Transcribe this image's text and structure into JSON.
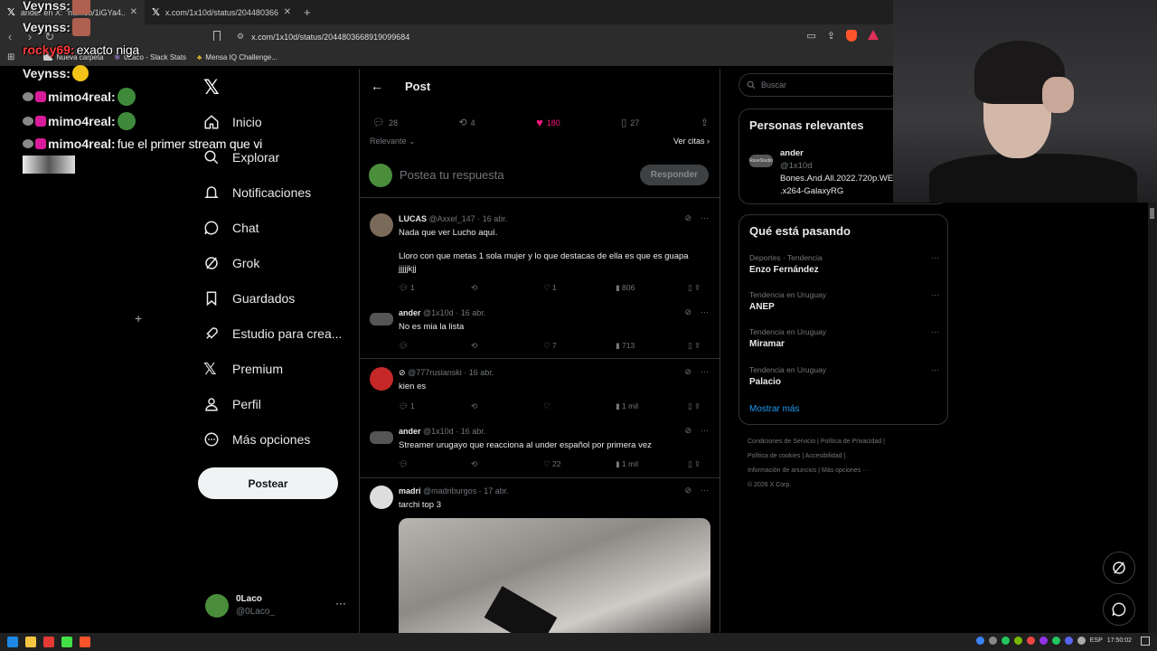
{
  "browser": {
    "tabs": [
      {
        "title": "ander en X: \"htt...co/1iGYa4...",
        "active": true
      },
      {
        "title": "x.com/1x10d/status/20448036689190",
        "active": false
      }
    ],
    "url": "x.com/1x10d/status/2044803668919099684",
    "bookmarks": [
      "Nueva carpeta",
      "0Laco - Slack Stats",
      "Mensa IQ Challenge..."
    ]
  },
  "chat": [
    {
      "name": "Veynss:",
      "msg": "",
      "emote": "face"
    },
    {
      "name": "Veynss:",
      "msg": "",
      "emote": "face"
    },
    {
      "name": "rocky69:",
      "msg": "exacto niga",
      "red": true
    },
    {
      "name": "Veynss:",
      "msg": "",
      "emote": "yellow"
    },
    {
      "name": "mimo4real:",
      "msg": "",
      "emote": "frog"
    },
    {
      "name": "mimo4real:",
      "msg": "",
      "emote": "frog"
    },
    {
      "name": "mimo4real:",
      "msg": "fue el primer stream que vi"
    }
  ],
  "nav": {
    "items": [
      "Inicio",
      "Explorar",
      "Notificaciones",
      "Chat",
      "Grok",
      "Guardados",
      "Estudio para crea...",
      "Premium",
      "Perfil",
      "Más opciones"
    ],
    "post_button": "Postear",
    "account": {
      "name": "0Laco",
      "handle": "@0Laco_"
    }
  },
  "main": {
    "title": "Post",
    "stats": {
      "replies": "28",
      "reposts": "4",
      "likes": "180",
      "bookmarks": "27"
    },
    "sort_label": "Relevante",
    "quotes_label": "Ver citas",
    "reply_placeholder": "Postea tu respuesta",
    "reply_button": "Responder",
    "tweets": [
      {
        "name": "LUCAS",
        "handle": "@Axxel_147",
        "date": "· 16 abr.",
        "text1": "Nada que ver Lucho aquí.",
        "text2": "Lloro con que metas 1 sola mujer y lo que destacas de ella es que es guapa jjjjjkjj",
        "replies": "1",
        "reposts": "",
        "likes": "1",
        "views": "806"
      },
      {
        "name": "ander",
        "handle": "@1x10d",
        "date": "· 16 abr.",
        "text1": "No es mia la lista",
        "replies": "",
        "reposts": "",
        "likes": "7",
        "views": "713"
      },
      {
        "name": "",
        "handle": "@777ruslanski",
        "date": "· 16 abr.",
        "text1": "kien es",
        "replies": "1",
        "reposts": "",
        "likes": "",
        "views": "1 mil"
      },
      {
        "name": "ander",
        "handle": "@1x10d",
        "date": "· 16 abr.",
        "text1": "Streamer urugayo que reacciona al under español por primera vez",
        "replies": "",
        "reposts": "",
        "likes": "22",
        "views": "1 mil"
      },
      {
        "name": "madri",
        "handle": "@madriburgos",
        "date": "· 17 abr.",
        "text1": "tarchi top 3"
      }
    ]
  },
  "right": {
    "search_placeholder": "Buscar",
    "relevant_title": "Personas relevantes",
    "person": {
      "name": "ander",
      "handle": "@1x10d",
      "bio1": "Bones.And.All.2022.720p.WEB",
      "bio2": ".x264-GalaxyRG",
      "avatar_label": "RaveStudio"
    },
    "trending_title": "Qué está pasando",
    "trends": [
      {
        "context": "Deportes · Tendencia",
        "name": "Enzo Fernández"
      },
      {
        "context": "Tendencia en Uruguay",
        "name": "ANEP"
      },
      {
        "context": "Tendencia en Uruguay",
        "name": "Miramar"
      },
      {
        "context": "Tendencia en Uruguay",
        "name": "Palacio"
      }
    ],
    "show_more": "Mostrar más",
    "footer": {
      "line1a": "Condiciones de Servicio",
      "line1b": "Política de Privacidad",
      "line2a": "Política de cookies",
      "line2b": "Accesibilidad",
      "line3a": "Información de anuncios",
      "line3b": "Más opciones ···",
      "copyright": "© 2026 X Corp."
    }
  },
  "taskbar": {
    "lang": "ESP",
    "time": "17:50:02"
  }
}
